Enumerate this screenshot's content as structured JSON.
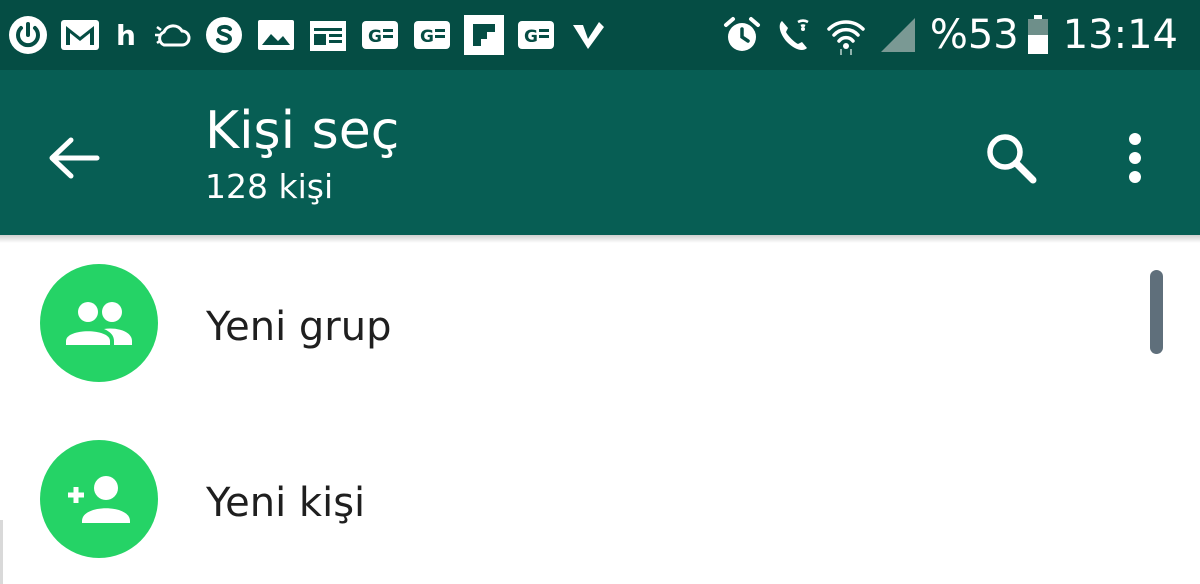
{
  "status_bar": {
    "left_icons": [
      "power-icon",
      "gmail-icon",
      "h-indicator",
      "cloud-sync-icon",
      "skype-icon",
      "image-icon",
      "news-icon",
      "google-news-icon",
      "google-news-icon",
      "flipboard-icon",
      "google-news-icon",
      "tasks-check-icon"
    ],
    "h_indicator": "h",
    "right_icons": [
      "alarm-icon",
      "wifi-calling-icon",
      "wifi-icon",
      "signal-icon",
      "battery-icon"
    ],
    "battery_text": "%53",
    "time": "13:14"
  },
  "app_bar": {
    "title": "Kişi seç",
    "subtitle": "128 kişi",
    "back_icon": "arrow-back-icon",
    "search_icon": "search-icon",
    "overflow_icon": "more-vert-icon"
  },
  "list": {
    "items": [
      {
        "label": "Yeni grup",
        "icon": "group-icon"
      },
      {
        "label": "Yeni kişi",
        "icon": "person-add-icon"
      }
    ]
  },
  "colors": {
    "status_bar_bg": "#054d44",
    "app_bar_bg": "#075e54",
    "avatar_bg": "#25d366",
    "text_primary": "#1f1f1f",
    "on_primary": "#ffffff"
  }
}
